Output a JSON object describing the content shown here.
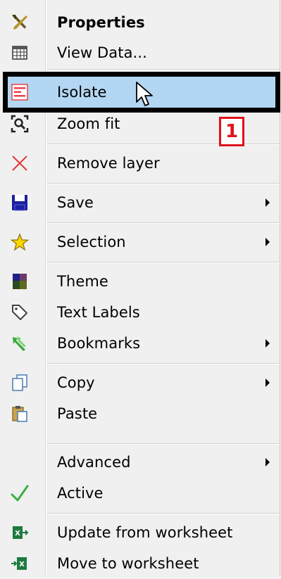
{
  "menu": {
    "items": [
      {
        "id": "properties",
        "label": "Properties",
        "bold": true,
        "icon": "tools-icon",
        "submenu": false
      },
      {
        "id": "view-data",
        "label": "View Data...",
        "icon": "table-icon",
        "submenu": false
      },
      {
        "id": "isolate",
        "label": "Isolate",
        "icon": "isolate-icon",
        "submenu": false,
        "highlighted": true
      },
      {
        "id": "zoom-fit",
        "label": "Zoom fit",
        "icon": "zoom-fit-icon",
        "submenu": false
      },
      {
        "id": "remove-layer",
        "label": "Remove layer",
        "icon": "red-x-icon",
        "submenu": false
      },
      {
        "id": "save",
        "label": "Save",
        "icon": "floppy-disk-icon",
        "submenu": true
      },
      {
        "id": "selection",
        "label": "Selection",
        "icon": "star-icon",
        "submenu": true
      },
      {
        "id": "theme",
        "label": "Theme",
        "icon": "theme-swatch-icon",
        "submenu": false
      },
      {
        "id": "text-labels",
        "label": "Text Labels",
        "icon": "tag-icon",
        "submenu": false
      },
      {
        "id": "bookmarks",
        "label": "Bookmarks",
        "icon": "bookmark-arrow-icon",
        "submenu": true
      },
      {
        "id": "copy",
        "label": "Copy",
        "icon": "copy-icon",
        "submenu": true
      },
      {
        "id": "paste",
        "label": "Paste",
        "icon": "paste-icon",
        "submenu": false
      },
      {
        "id": "advanced",
        "label": "Advanced",
        "icon": "",
        "submenu": true
      },
      {
        "id": "active",
        "label": "Active",
        "icon": "checkmark-icon",
        "submenu": false
      },
      {
        "id": "update-from-worksheet",
        "label": "Update from worksheet",
        "icon": "excel-import-icon",
        "submenu": false
      },
      {
        "id": "move-to-worksheet",
        "label": "Move to worksheet",
        "icon": "excel-export-icon",
        "submenu": false
      }
    ]
  },
  "annotation": {
    "badge_label": "1"
  },
  "colors": {
    "highlight": "#b3d7f3",
    "annotation_red": "#e0111b",
    "checkmark_green": "#3cb043"
  }
}
